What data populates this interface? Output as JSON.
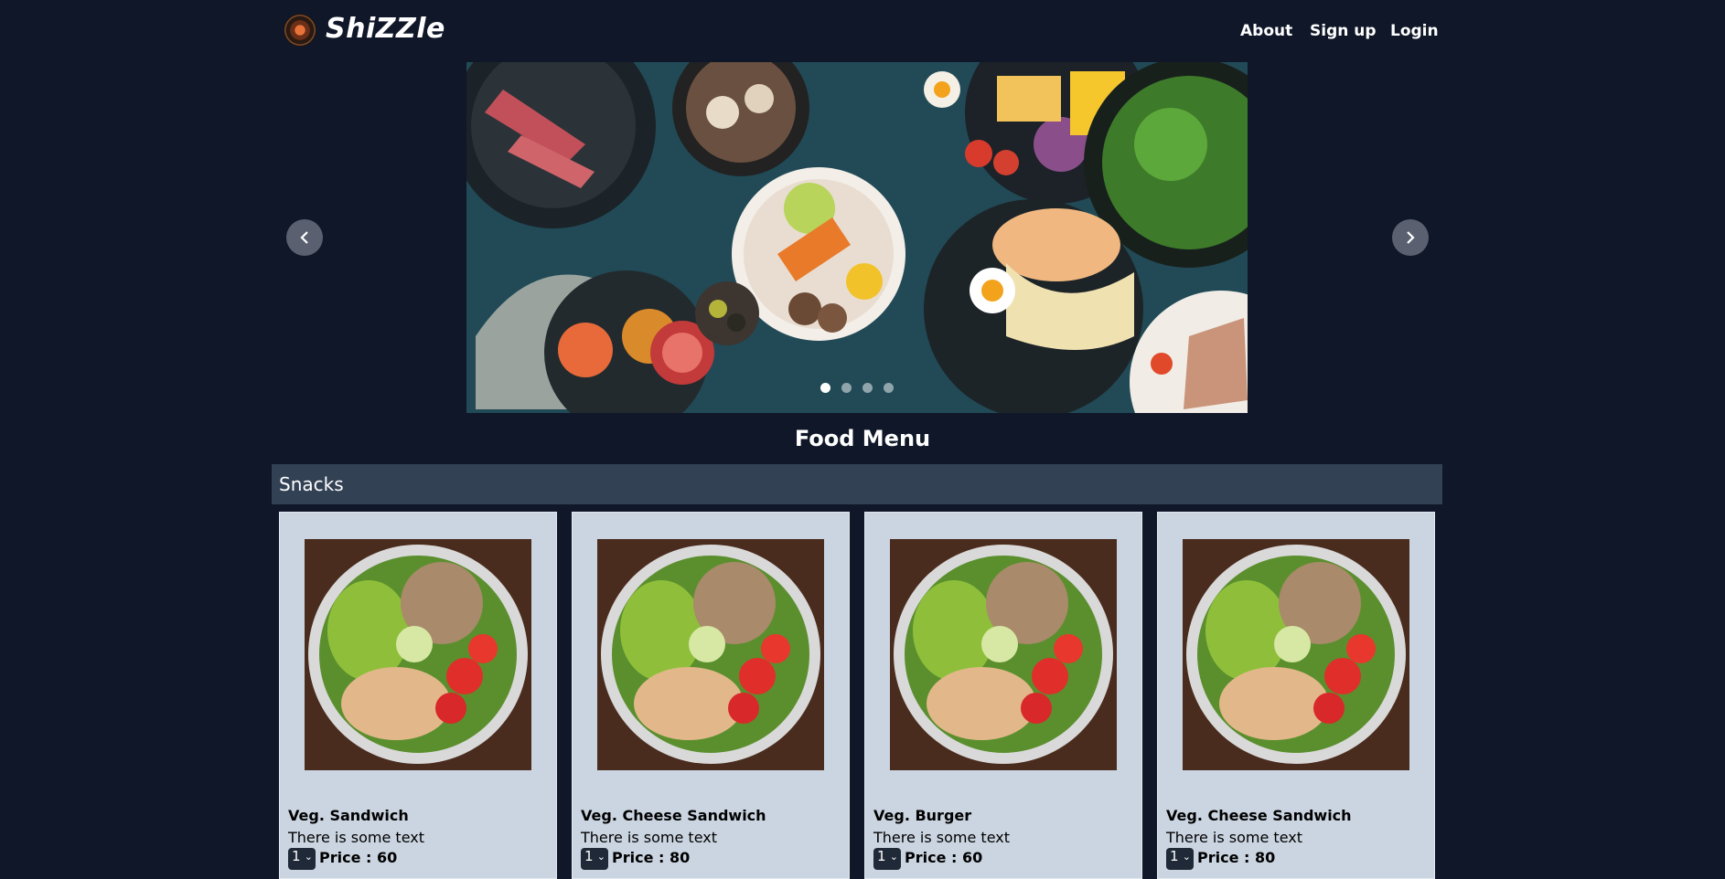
{
  "header": {
    "brand": "ShiZZle",
    "links": [
      "About",
      "Sign up",
      "Login"
    ]
  },
  "carousel": {
    "slide_count": 4,
    "active_slide": 1
  },
  "page_title": "Food Menu",
  "category": "Snacks",
  "items": [
    {
      "name": "Veg. Sandwich",
      "desc": "There is some text",
      "qty": "1",
      "price": "Price : 60"
    },
    {
      "name": "Veg. Cheese Sandwich",
      "desc": "There is some text",
      "qty": "1",
      "price": "Price : 80"
    },
    {
      "name": "Veg. Burger",
      "desc": "There is some text",
      "qty": "1",
      "price": "Price : 60"
    },
    {
      "name": "Veg. Cheese Sandwich",
      "desc": "There is some text",
      "qty": "1",
      "price": "Price : 80"
    }
  ],
  "colors": {
    "background": "#0f1729",
    "category_bar": "#334155",
    "card": "#cbd5e1"
  }
}
